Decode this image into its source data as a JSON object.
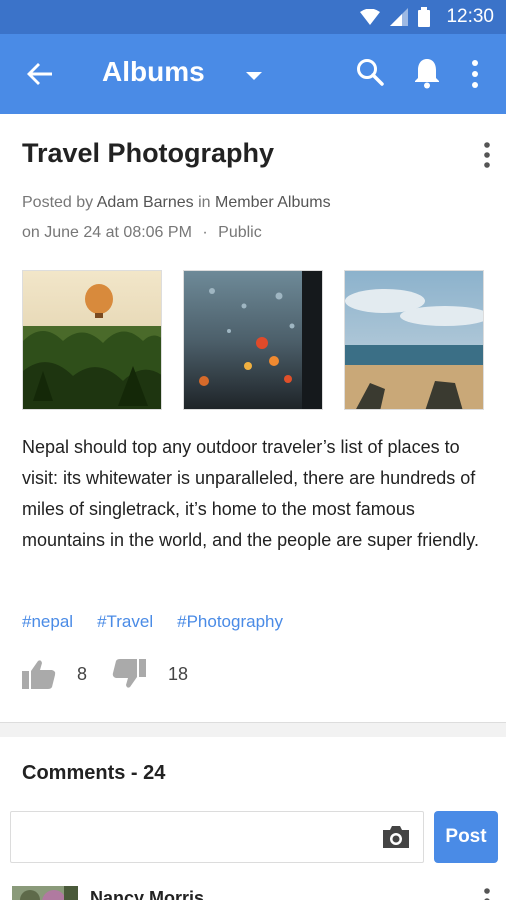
{
  "status_bar": {
    "time": "12:30"
  },
  "app_bar": {
    "title": "Albums"
  },
  "post": {
    "title": "Travel Photography",
    "meta": {
      "posted_by_prefix": "Posted by",
      "author": "Adam Barnes",
      "in_word": "in",
      "album": "Member Albums",
      "date": "on June 24 at 08:06 PM",
      "separator": "·",
      "privacy": "Public"
    },
    "body": "Nepal should top any outdoor traveler’s list of places to visit: its whitewater is unparalleled, there are hundreds of miles of singletrack, it’s home to the most famous mountains in the world, and the people are super friendly.",
    "tags": [
      "#nepal",
      "#Travel",
      "#Photography"
    ],
    "likes": "8",
    "dislikes": "18"
  },
  "comments": {
    "heading": "Comments - 24",
    "input_placeholder": "",
    "post_label": "Post",
    "first_commenter": "Nancy Morris"
  },
  "colors": {
    "status_bar": "#3b73c9",
    "app_bar": "#4a8be6",
    "accent": "#4a8be6"
  },
  "icons": {
    "back": "arrow-left-icon",
    "dropdown": "caret-down-icon",
    "search": "search-icon",
    "notifications": "bell-icon",
    "menu": "more-vert-icon",
    "like": "thumbs-up-icon",
    "dislike": "thumbs-down-icon",
    "camera": "camera-icon"
  }
}
